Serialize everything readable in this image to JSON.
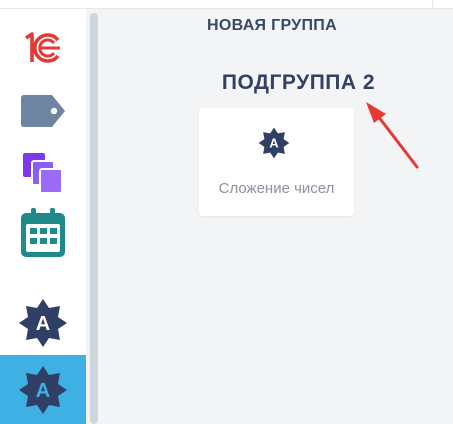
{
  "sidebar": {
    "items": [
      {
        "icon": "1c-logo-icon"
      },
      {
        "icon": "tag-icon"
      },
      {
        "icon": "copy-pages-icon"
      },
      {
        "icon": "calendar-icon"
      },
      {
        "icon": "badge-a-icon"
      },
      {
        "icon": "badge-a-icon",
        "active": true
      }
    ]
  },
  "main": {
    "group_title": "НОВАЯ ГРУППА",
    "subgroup_title": "ПОДГРУППА 2",
    "tiles": [
      {
        "label": "Сложение чисел",
        "icon": "badge-a-icon"
      }
    ]
  },
  "colors": {
    "accent": "#3fb0e3",
    "title": "#3a4867",
    "badge": "#2f3f66",
    "arrow": "#e53935",
    "logo_red": "#e53935",
    "tag": "#6f84a0",
    "pages": "#8b5cf6",
    "calendar": "#1f8a8a"
  }
}
